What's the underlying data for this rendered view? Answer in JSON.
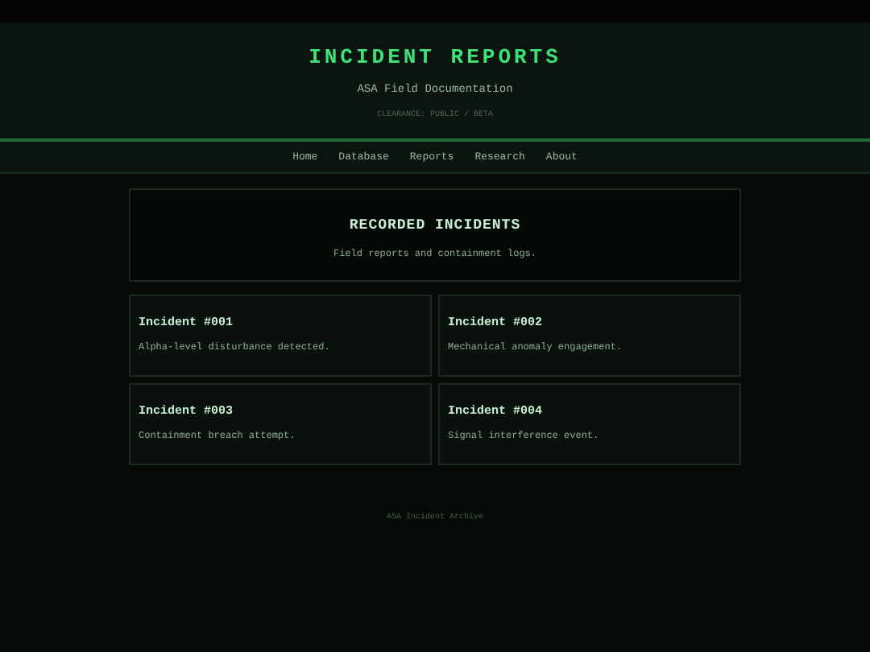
{
  "header": {
    "title": "INCIDENT REPORTS",
    "subtitle": "ASA Field Documentation",
    "clearance": "CLEARANCE: PUBLIC / BETA"
  },
  "nav": [
    {
      "label": "Home"
    },
    {
      "label": "Database"
    },
    {
      "label": "Reports"
    },
    {
      "label": "Research"
    },
    {
      "label": "About"
    }
  ],
  "intro": {
    "heading": "RECORDED INCIDENTS",
    "text": "Field reports and containment logs."
  },
  "incidents": [
    {
      "title": "Incident #001",
      "summary": "Alpha-level disturbance detected."
    },
    {
      "title": "Incident #002",
      "summary": "Mechanical anomaly engagement."
    },
    {
      "title": "Incident #003",
      "summary": "Containment breach attempt."
    },
    {
      "title": "Incident #004",
      "summary": "Signal interference event."
    }
  ],
  "footer": "ASA Incident Archive"
}
